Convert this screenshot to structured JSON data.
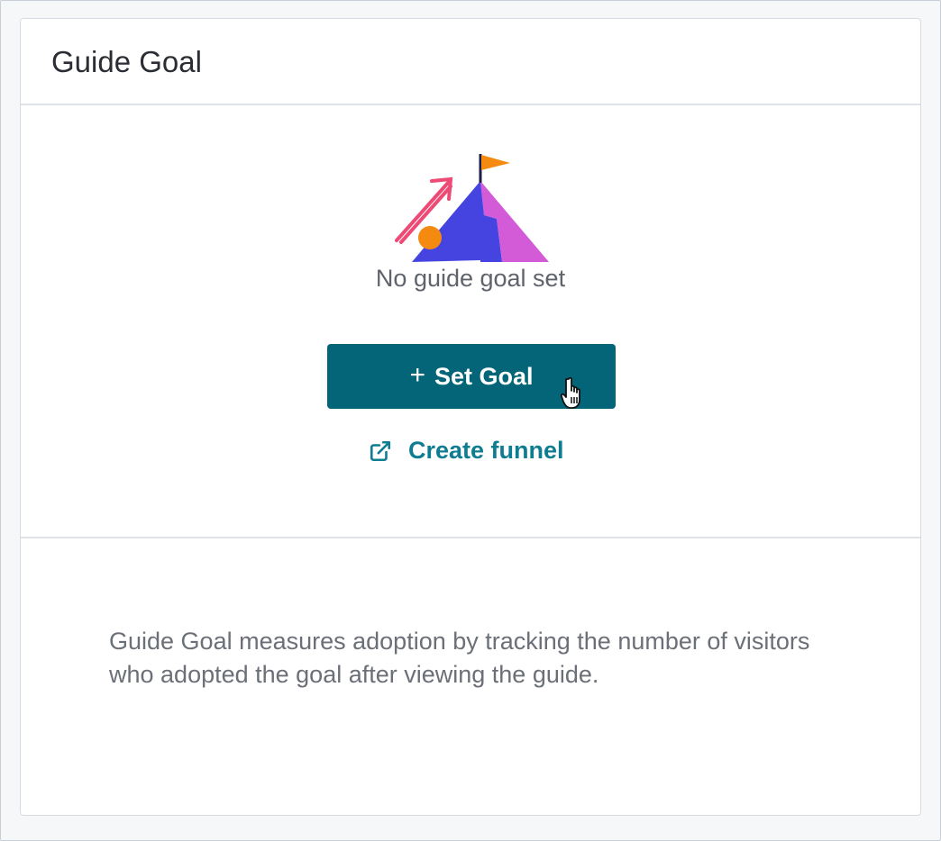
{
  "card": {
    "title": "Guide Goal"
  },
  "empty_state": {
    "illustration": "mountain-flag-illustration",
    "message": "No guide goal set"
  },
  "actions": {
    "set_goal": {
      "icon": "plus-icon",
      "label": "Set Goal"
    },
    "create_funnel": {
      "icon": "external-link-icon",
      "label": "Create funnel"
    }
  },
  "footer": {
    "description": "Guide Goal measures adoption by tracking the number of visitors who adopted the goal after viewing the guide."
  },
  "colors": {
    "primary_button": "#046579",
    "link": "#0f7d91",
    "mountain_blue": "#4544e0",
    "mountain_pink": "#d35bd8",
    "flag_orange": "#f48a10",
    "arrow_pink": "#ee4a76"
  }
}
